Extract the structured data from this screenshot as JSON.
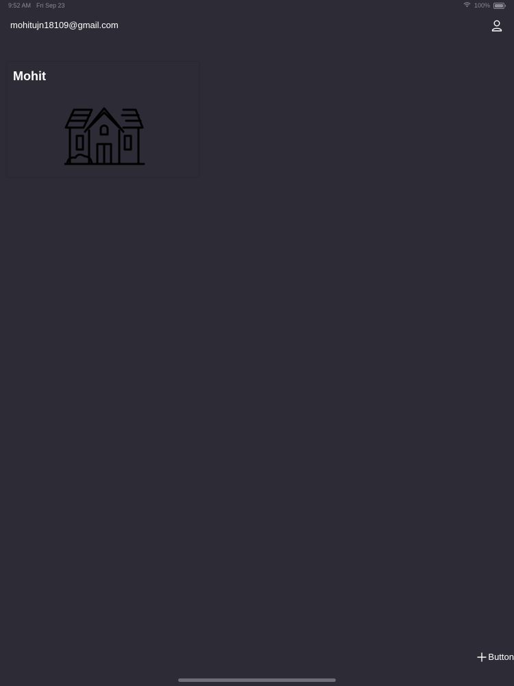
{
  "status_bar": {
    "time": "9:52 AM",
    "date": "Fri Sep 23",
    "battery_text": "100%",
    "icons": [
      "wifi-icon",
      "battery-icon"
    ]
  },
  "header": {
    "email": "mohitujn18109@gmail.com",
    "profile_icon": "person-icon"
  },
  "cards": [
    {
      "title": "Mohit",
      "icon": "house-icon"
    }
  ],
  "footer": {
    "add_button_label": "Button",
    "add_icon": "plus-icon"
  },
  "colors": {
    "background": "#2d2b35",
    "text": "#ffffff",
    "muted": "#8c8a96"
  }
}
